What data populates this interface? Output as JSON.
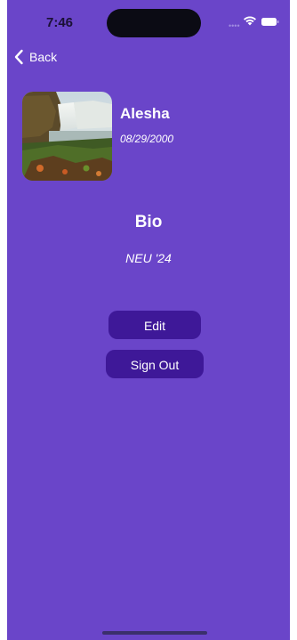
{
  "status_bar": {
    "time": "7:46",
    "signal_icon": "cellular-signal-icon",
    "wifi_icon": "wifi-icon",
    "battery_icon": "battery-icon"
  },
  "nav": {
    "back_label": "Back",
    "back_icon": "chevron-left-icon"
  },
  "profile": {
    "name": "Alesha",
    "dob": "08/29/2000",
    "avatar": "waterfall-landscape-photo"
  },
  "bio": {
    "title": "Bio",
    "text": "NEU '24"
  },
  "actions": {
    "edit_label": "Edit",
    "signout_label": "Sign Out"
  },
  "colors": {
    "background": "#6a45c9",
    "button": "#3e1898",
    "text": "#ffffff"
  }
}
